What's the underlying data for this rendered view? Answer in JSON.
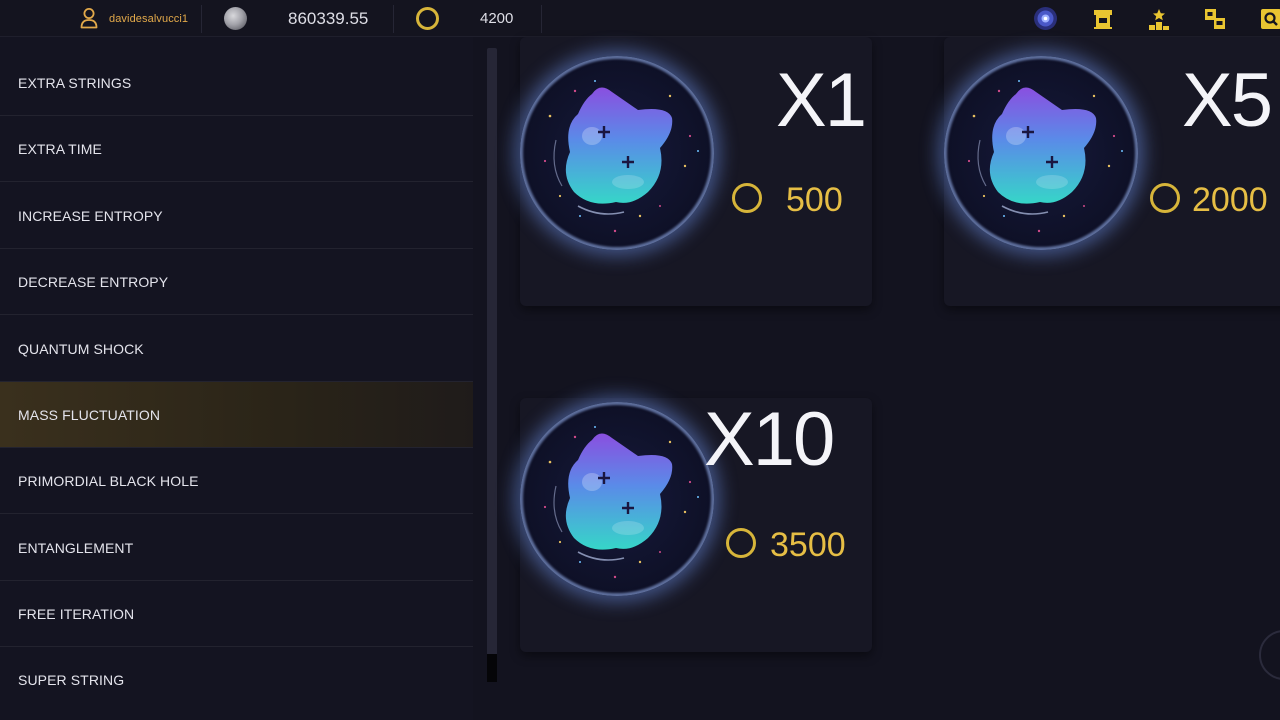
{
  "topbar": {
    "username": "davidesalvucci1",
    "balance": "860339.55",
    "coins": "4200",
    "icons": [
      "galaxy-icon",
      "shop-icon",
      "leaderboard-icon",
      "collection-icon",
      "search-icon"
    ]
  },
  "sidebar": {
    "items": [
      {
        "label": "EXTRA STRINGS"
      },
      {
        "label": "EXTRA TIME"
      },
      {
        "label": "INCREASE ENTROPY"
      },
      {
        "label": "DECREASE ENTROPY"
      },
      {
        "label": "QUANTUM SHOCK"
      },
      {
        "label": "MASS FLUCTUATION"
      },
      {
        "label": "PRIMORDIAL BLACK HOLE"
      },
      {
        "label": "ENTANGLEMENT"
      },
      {
        "label": "FREE ITERATION"
      },
      {
        "label": "SUPER STRING"
      }
    ],
    "active_item": "MASS FLUCTUATION"
  },
  "packs": [
    {
      "quantity": "X1",
      "price": "500"
    },
    {
      "quantity": "X5",
      "price": "2000"
    },
    {
      "quantity": "X10",
      "price": "3500"
    }
  ],
  "colors": {
    "accent_gold": "#e6be45",
    "username": "#e2a94a",
    "background": "#13131f"
  }
}
